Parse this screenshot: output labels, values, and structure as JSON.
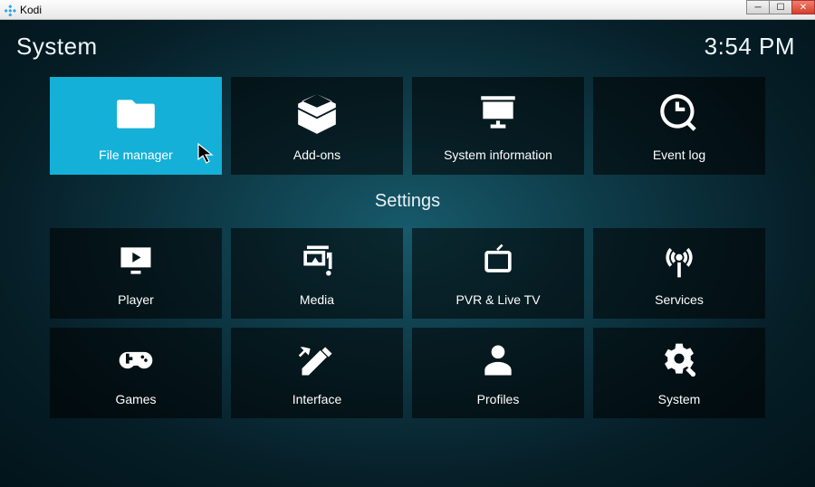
{
  "window": {
    "title": "Kodi"
  },
  "header": {
    "title": "System",
    "clock": "3:54 PM"
  },
  "top_row": [
    {
      "label": "File manager",
      "icon": "folder",
      "selected": true
    },
    {
      "label": "Add-ons",
      "icon": "box"
    },
    {
      "label": "System information",
      "icon": "presentation"
    },
    {
      "label": "Event log",
      "icon": "clock-search"
    }
  ],
  "section_label": "Settings",
  "settings_rows": [
    [
      {
        "label": "Player",
        "icon": "monitor-play"
      },
      {
        "label": "Media",
        "icon": "media"
      },
      {
        "label": "PVR & Live TV",
        "icon": "tv"
      },
      {
        "label": "Services",
        "icon": "antenna"
      }
    ],
    [
      {
        "label": "Games",
        "icon": "gamepad"
      },
      {
        "label": "Interface",
        "icon": "tools"
      },
      {
        "label": "Profiles",
        "icon": "person"
      },
      {
        "label": "System",
        "icon": "gear"
      }
    ]
  ]
}
